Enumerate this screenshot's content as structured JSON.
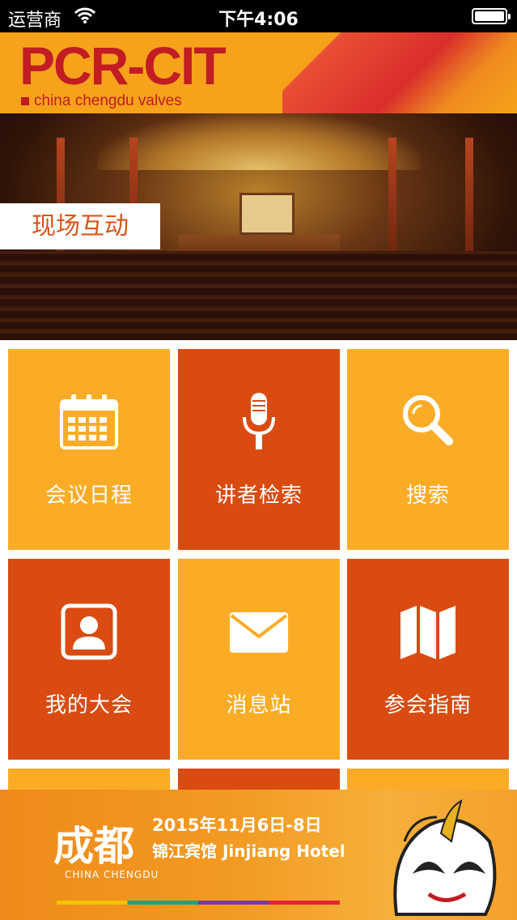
{
  "status_bar": {
    "carrier": "运营商",
    "time": "下午4:06"
  },
  "header": {
    "logo": "PCR-CIT",
    "tagline": "china chengdu valves"
  },
  "hero": {
    "label": "现场互动"
  },
  "tiles": [
    {
      "label": "会议日程",
      "icon": "calendar-icon",
      "color": "#fbac27"
    },
    {
      "label": "讲者检索",
      "icon": "microphone-icon",
      "color": "#d94b10"
    },
    {
      "label": "搜索",
      "icon": "search-icon",
      "color": "#fbac27"
    },
    {
      "label": "我的大会",
      "icon": "profile-icon",
      "color": "#d94b10"
    },
    {
      "label": "消息站",
      "icon": "mail-icon",
      "color": "#fbac27"
    },
    {
      "label": "参会指南",
      "icon": "map-icon",
      "color": "#d94b10"
    }
  ],
  "footer": {
    "city_cn": "成都",
    "city_en": "CHINA CHENGDU",
    "date": "2015年11月6日-8日",
    "venue": "锦江宾馆 Jinjiang Hotel"
  },
  "colors": {
    "tile_yellow": "#fbac27",
    "tile_red": "#d94b10",
    "brand_red": "#c21c24",
    "header_bg": "#f6a21a"
  }
}
